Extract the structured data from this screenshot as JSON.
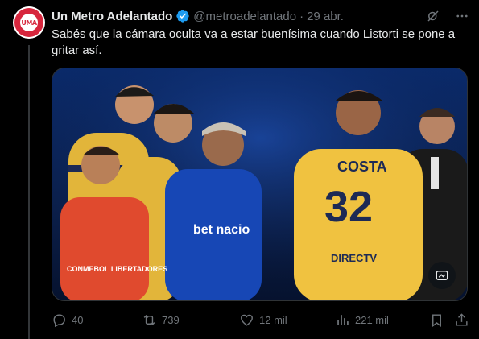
{
  "author": {
    "name": "Un Metro Adelantado",
    "handle": "@metroadelantado",
    "avatar_text": "UMA",
    "verified": true
  },
  "tweet": {
    "date": "29 abr.",
    "text": "Sabés que la cámara oculta va a estar buenísima cuando Listorti se pone a gritar así."
  },
  "media": {
    "jersey_name": "COSTA",
    "jersey_number": "32",
    "sponsor_left": "bet nacio",
    "sponsor_right": "DIRECTV",
    "bib_text": "CONMEBOL LIBERTADORES"
  },
  "stats": {
    "replies": "40",
    "reposts": "739",
    "likes": "12 mil",
    "views": "221 mil"
  },
  "colors": {
    "accent": "#1d9bf0",
    "muted": "#71767b",
    "background": "#000000"
  },
  "icons": [
    "grok-icon",
    "more-icon",
    "verified-icon",
    "reply-icon",
    "repost-icon",
    "like-icon",
    "views-icon",
    "bookmark-icon",
    "share-icon",
    "alt-text-icon"
  ]
}
